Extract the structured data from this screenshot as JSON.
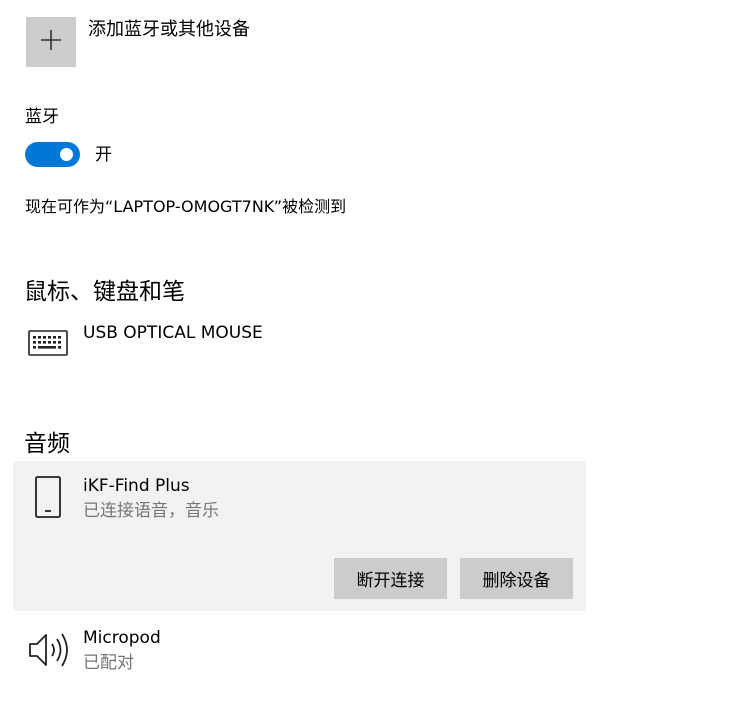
{
  "add_device": {
    "label": "添加蓝牙或其他设备",
    "icon": "plus-icon"
  },
  "bluetooth": {
    "title": "蓝牙",
    "toggle_state": "开",
    "enabled": true,
    "accent_color": "#0078d7",
    "discoverable_text": "现在可作为“LAPTOP-OMOGT7NK”被检测到"
  },
  "mouse_section": {
    "title": "鼠标、键盘和笔",
    "devices": [
      {
        "name": "USB OPTICAL MOUSE",
        "icon": "keyboard-icon"
      }
    ]
  },
  "audio_section": {
    "title": "音频",
    "devices": [
      {
        "name": "iKF-Find Plus",
        "status": "已连接语音，音乐",
        "icon": "phone-icon",
        "selected": true,
        "actions": {
          "disconnect": "断开连接",
          "remove": "删除设备"
        }
      },
      {
        "name": "Micropod",
        "status": "已配对",
        "icon": "speaker-icon"
      }
    ]
  }
}
